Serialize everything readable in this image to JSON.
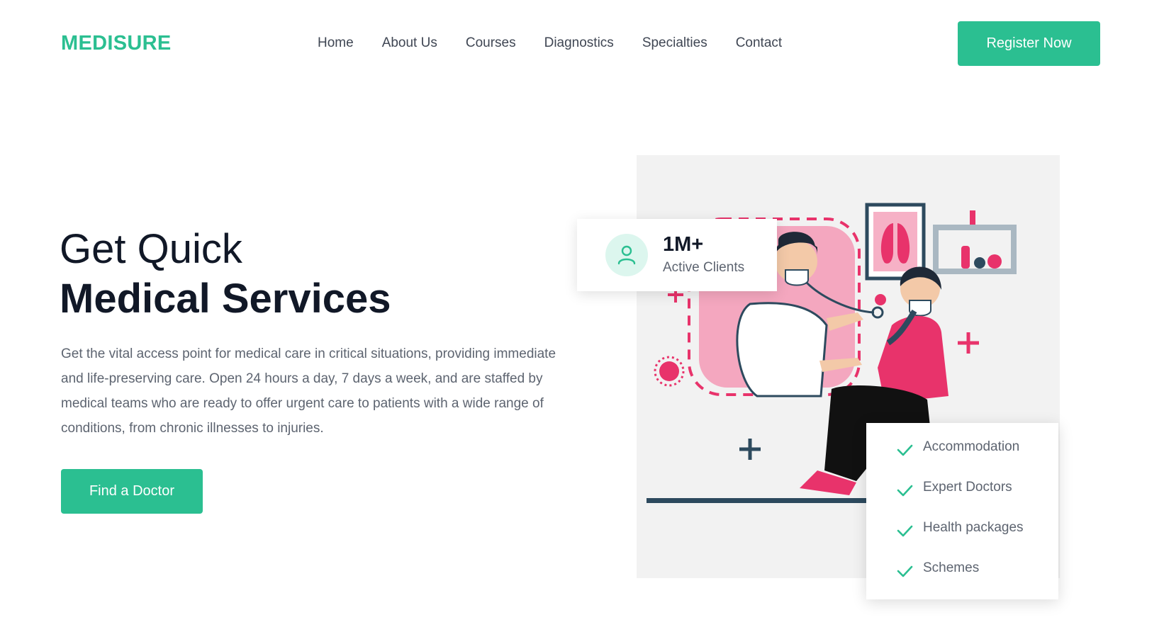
{
  "brand": {
    "name": "MEDISURE",
    "accent_color": "#2bbf91"
  },
  "nav": {
    "items": [
      "Home",
      "About Us",
      "Courses",
      "Diagnostics",
      "Specialties",
      "Contact"
    ],
    "register_label": "Register Now"
  },
  "hero": {
    "title_line1": "Get Quick",
    "title_line2": "Medical Services",
    "description": "Get the vital access point for medical care in critical situations, providing immediate and life-preserving care. Open 24 hours a day, 7 days a week, and are staffed by medical teams who are ready to offer urgent care to patients with a wide range of conditions, from chronic illnesses to injuries.",
    "cta_label": "Find a Doctor"
  },
  "stat": {
    "icon": "user-icon",
    "value": "1M+",
    "label": "Active Clients"
  },
  "features": {
    "icon": "check-icon",
    "items": [
      "Accommodation",
      "Expert Doctors",
      "Health packages",
      "Schemes"
    ]
  },
  "illustration": {
    "description_icon": "doctor-patient-illustration"
  }
}
